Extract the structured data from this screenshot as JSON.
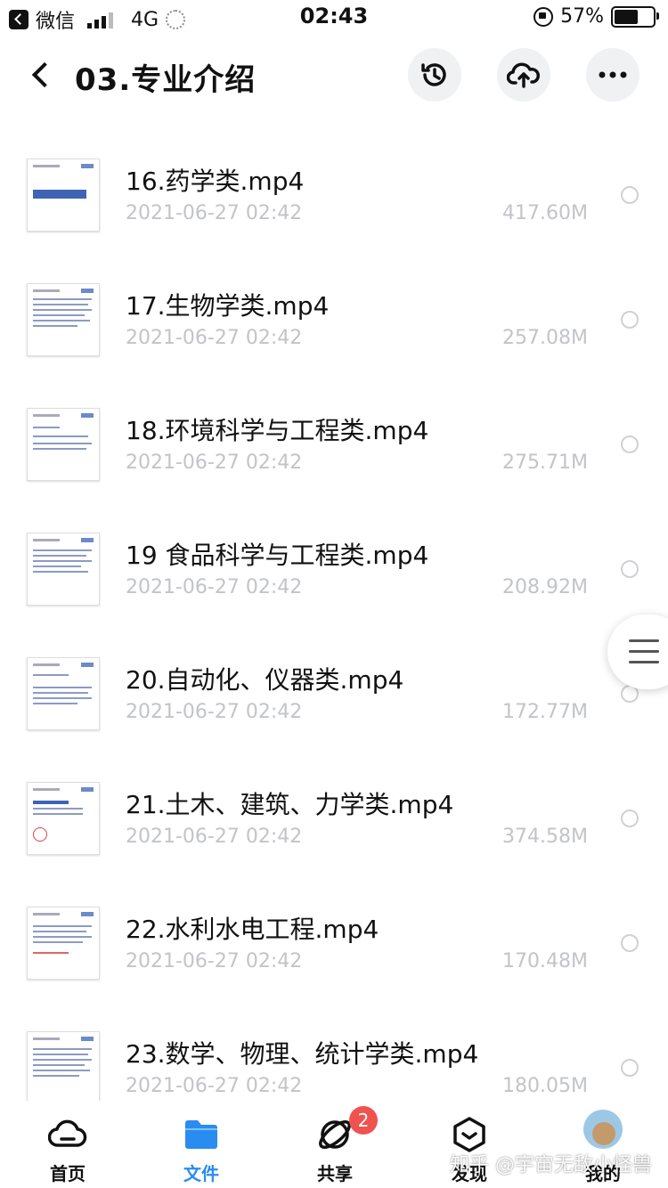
{
  "status_bar": {
    "app": "微信",
    "network": "4G",
    "time": "02:43",
    "battery": "57%",
    "battery_level": 0.57
  },
  "header": {
    "title": "03.专业介绍",
    "back_icon": "chevron-left-icon",
    "history_icon": "history-icon",
    "upload_icon": "cloud-upload-icon",
    "more_icon": "more-dots-icon"
  },
  "files": [
    {
      "name": "16.药学类.mp4",
      "date": "2021-06-27 02:42",
      "size": "417.60M"
    },
    {
      "name": "17.生物学类.mp4",
      "date": "2021-06-27 02:42",
      "size": "257.08M"
    },
    {
      "name": "18.环境科学与工程类.mp4",
      "date": "2021-06-27 02:42",
      "size": "275.71M"
    },
    {
      "name": "19 食品科学与工程类.mp4",
      "date": "2021-06-27 02:42",
      "size": "208.92M"
    },
    {
      "name": "20.自动化、仪器类.mp4",
      "date": "2021-06-27 02:42",
      "size": "172.77M"
    },
    {
      "name": "21.土木、建筑、力学类.mp4",
      "date": "2021-06-27 02:42",
      "size": "374.58M"
    },
    {
      "name": "22.水利水电工程.mp4",
      "date": "2021-06-27 02:42",
      "size": "170.48M"
    },
    {
      "name": "23.数学、物理、统计学类.mp4",
      "date": "2021-06-27 02:42",
      "size": "180.05M"
    }
  ],
  "tabs": [
    {
      "label": "首页",
      "icon": "home-cloud-icon"
    },
    {
      "label": "文件",
      "icon": "folder-icon",
      "active": true
    },
    {
      "label": "共享",
      "icon": "share-orbit-icon",
      "badge": "2"
    },
    {
      "label": "发现",
      "icon": "discover-box-icon"
    },
    {
      "label": "我的",
      "icon": "avatar"
    }
  ],
  "watermark": "知乎 @宇宙无敌小怪兽",
  "colors": {
    "accent": "#2b8cf0",
    "badge": "#f0524f",
    "meta_text": "#c2c4c8"
  }
}
